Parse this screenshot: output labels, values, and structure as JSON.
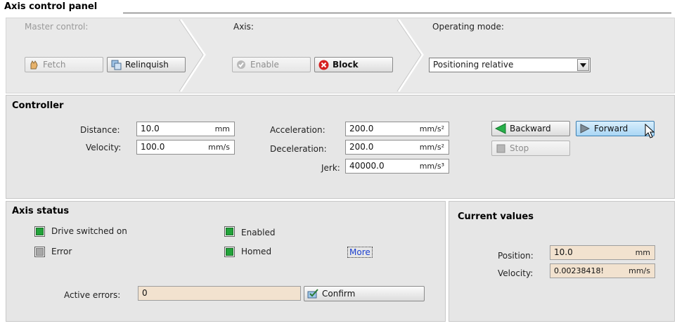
{
  "title": "Axis control panel",
  "master": {
    "label": "Master control:",
    "fetch": "Fetch",
    "relinquish": "Relinquish"
  },
  "axis": {
    "label": "Axis:",
    "enable": "Enable",
    "block": "Block"
  },
  "mode": {
    "label": "Operating mode:",
    "value": "Positioning relative"
  },
  "controller": {
    "title": "Controller",
    "distance": {
      "label": "Distance:",
      "value": "10.0",
      "unit": "mm"
    },
    "velocity": {
      "label": "Velocity:",
      "value": "100.0",
      "unit": "mm/s"
    },
    "acceleration": {
      "label": "Acceleration:",
      "value": "200.0",
      "unit": "mm/s²"
    },
    "deceleration": {
      "label": "Deceleration:",
      "value": "200.0",
      "unit": "mm/s²"
    },
    "jerk": {
      "label": "Jerk:",
      "value": "40000.0",
      "unit": "mm/s³"
    },
    "backward": "Backward",
    "forward": "Forward",
    "stop": "Stop"
  },
  "status": {
    "title": "Axis status",
    "drive": "Drive switched on",
    "error": "Error",
    "enabled": "Enabled",
    "homed": "Homed",
    "more": "More",
    "active_errors_label": "Active errors:",
    "active_errors_value": "0",
    "confirm": "Confirm"
  },
  "current": {
    "title": "Current values",
    "position": {
      "label": "Position:",
      "value": "10.0",
      "unit": "mm"
    },
    "velocity": {
      "label": "Velocity:",
      "value": "0.00238418!",
      "unit": "mm/s"
    }
  },
  "colors": {
    "lamp_on": "#22a33a",
    "lamp_off": "#a7a7a7",
    "block_icon": "#d62020",
    "arrow_green": "#27b04a"
  }
}
